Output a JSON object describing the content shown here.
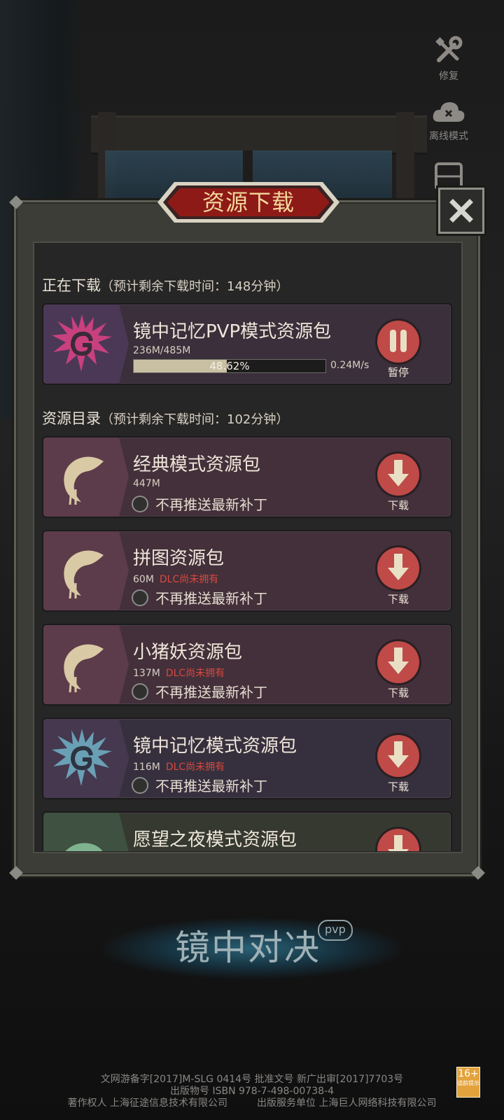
{
  "side_menu": {
    "repair_label": "修复",
    "offline_label": "离线模式"
  },
  "panel": {
    "title": "资源下载",
    "close_icon": "close-x-icon"
  },
  "downloading": {
    "label": "正在下载",
    "eta": "（预计剩余下载时间：148分钟）",
    "item": {
      "name": "镜中记忆PVP模式资源包",
      "icon": "swirl-spiky-icon",
      "progress_size": "236M/485M",
      "progress_percent": "48.62%",
      "progress_value": 0.4862,
      "speed": "0.24M/s",
      "action_label": "暂停",
      "accent": "#bf4a47"
    }
  },
  "catalog": {
    "label": "资源目录",
    "eta": "（预计剩余下载时间：102分钟）",
    "items": [
      {
        "name": "经典模式资源包",
        "size": "447M",
        "dlc": "",
        "checkbox_label": "不再推送最新补丁",
        "action_label": "下载",
        "icon": "crescent-swirl-icon"
      },
      {
        "name": "拼图资源包",
        "size": "60M",
        "dlc": "DLC尚未拥有",
        "checkbox_label": "不再推送最新补丁",
        "action_label": "下载",
        "icon": "crescent-swirl-icon"
      },
      {
        "name": "小猪妖资源包",
        "size": "137M",
        "dlc": "DLC尚未拥有",
        "checkbox_label": "不再推送最新补丁",
        "action_label": "下载",
        "icon": "crescent-swirl-icon"
      },
      {
        "name": "镜中记忆模式资源包",
        "size": "116M",
        "dlc": "DLC尚未拥有",
        "checkbox_label": "不再推送最新补丁",
        "action_label": "下载",
        "icon": "swirl-spiky-icon"
      },
      {
        "name": "愿望之夜模式资源包",
        "size": "",
        "dlc": "",
        "checkbox_label": "",
        "action_label": "",
        "icon": "leaf-swirl-icon"
      }
    ]
  },
  "footer": {
    "logo": "镜中对决",
    "logo_badge": "pvp",
    "line1": "文网游备字[2017]M-SLG 0414号 批准文号 新广出审[2017]7703号",
    "line2": "出版物号 ISBN 978-7-498-00738-4",
    "line3": "著作权人 上海征途信息技术有限公司　　　出版服务单位 上海巨人网络科技有限公司",
    "age_rating": "16+",
    "age_note": "适龄提示"
  }
}
